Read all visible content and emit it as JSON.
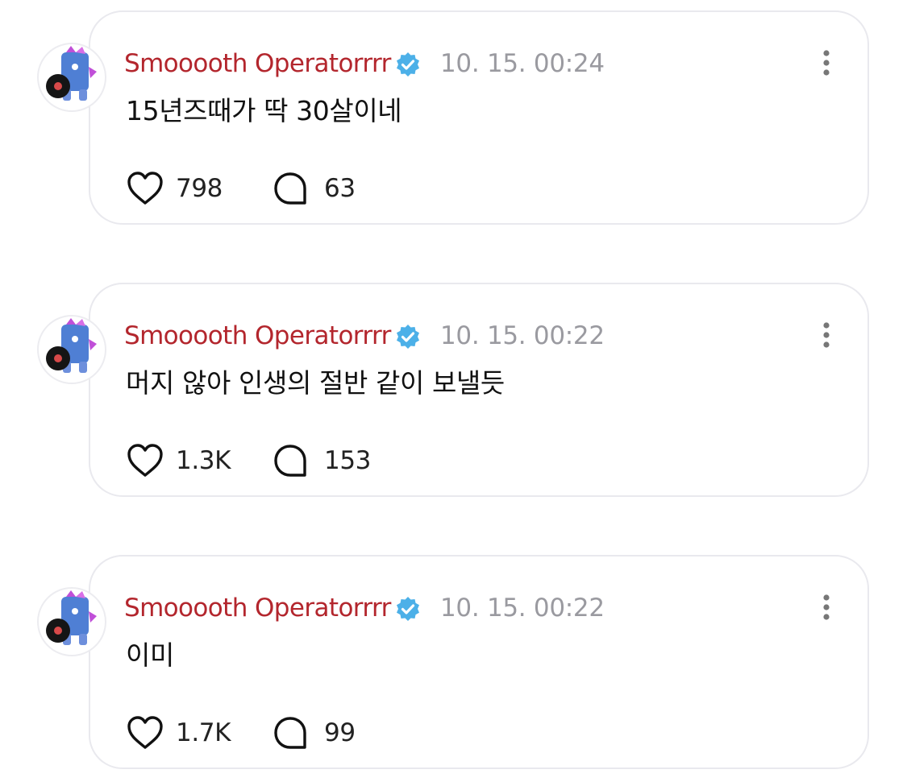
{
  "posts": [
    {
      "author": "Smooooth Operatorrrr",
      "time": "10. 15. 00:24",
      "text": "15년즈때가 딱 30살이네",
      "likes": "798",
      "replies": "63"
    },
    {
      "author": "Smooooth Operatorrrr",
      "time": "10. 15. 00:22",
      "text": "머지 않아 인생의 절반 같이 보낼듯",
      "likes": "1.3K",
      "replies": "153"
    },
    {
      "author": "Smooooth Operatorrrr",
      "time": "10. 15. 00:22",
      "text": "이미",
      "likes": "1.7K",
      "replies": "99"
    }
  ],
  "icons": {
    "verified": "verified-badge-icon",
    "more": "more-vertical-icon",
    "like": "heart-icon",
    "reply": "speech-bubble-icon"
  },
  "colors": {
    "author": "#b3262d",
    "verified": "#4cb0e8",
    "timestamp": "#9a9aa0",
    "card_border": "#e9e9ee"
  }
}
